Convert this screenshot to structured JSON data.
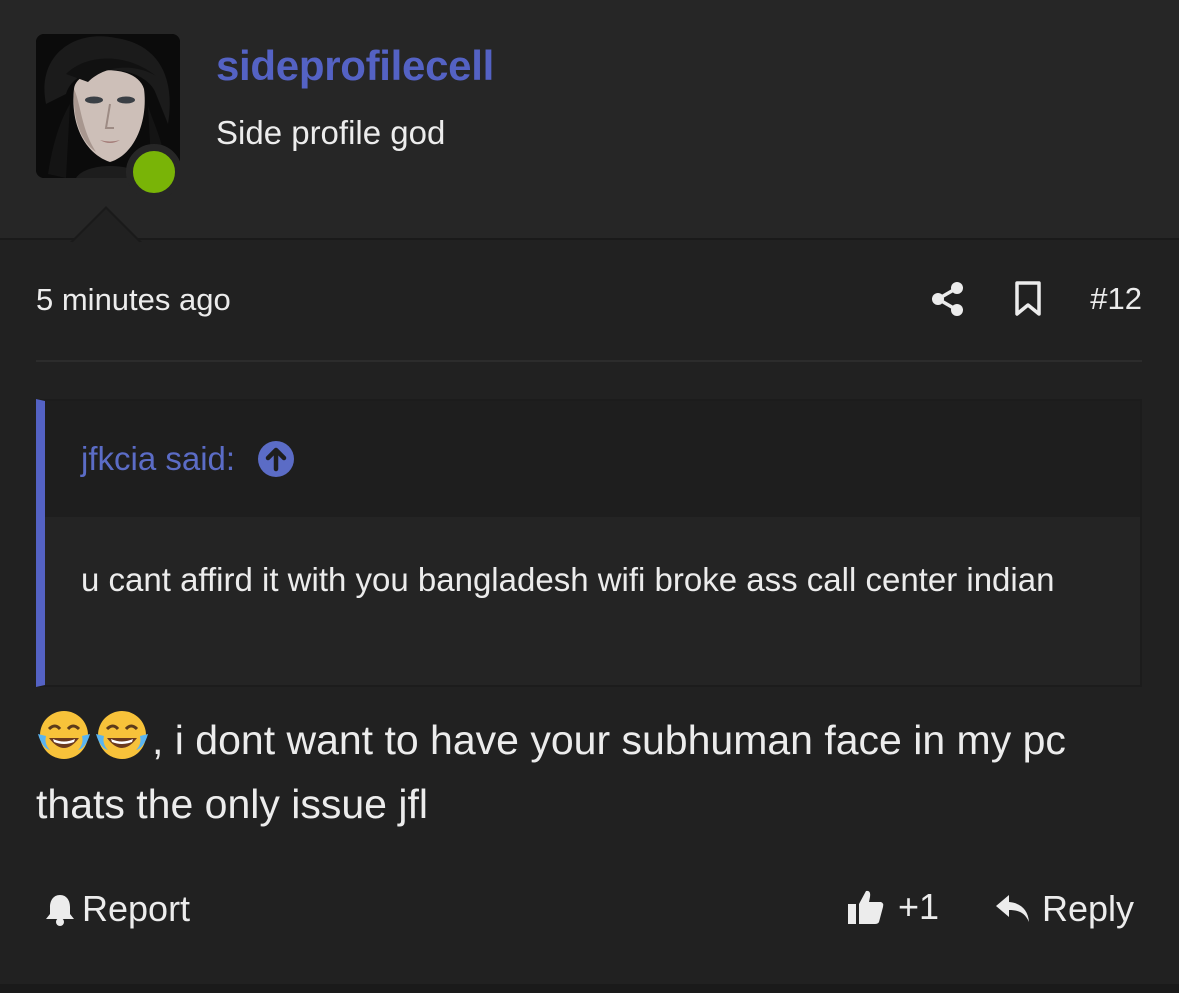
{
  "user": {
    "username": "sideprofilecell",
    "title": "Side profile god",
    "online": true,
    "avatar_icon": "user-avatar-photo",
    "colors": {
      "username": "#5462c4",
      "online": "#79b407"
    }
  },
  "post": {
    "time": "5 minutes ago",
    "number": "#12",
    "share_icon": "share-icon",
    "bookmark_icon": "bookmark-icon"
  },
  "quote": {
    "author": "jfkcia said:",
    "arrow_icon": "arrow-up-circle-icon",
    "text": "u cant affird it with you bangladesh wifi broke ass call center indian"
  },
  "message": {
    "emoji_icon": "face-with-tears-of-joy-emoji",
    "text": ", i dont want to have your subhuman face in my pc thats the only issue jfl"
  },
  "actions": {
    "report": "Report",
    "like_count": "+1",
    "reply": "Reply"
  }
}
